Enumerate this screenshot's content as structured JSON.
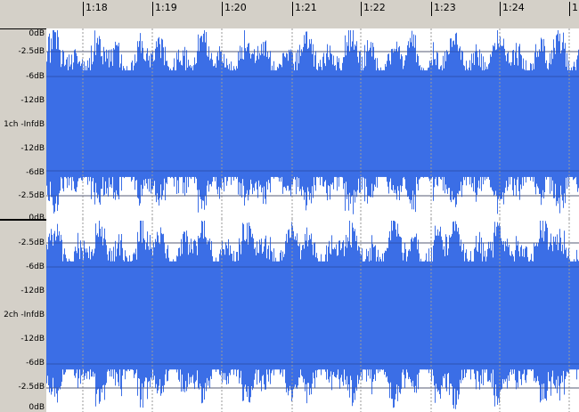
{
  "timeline": {
    "ticks": [
      "1:18",
      "1:19",
      "1:20",
      "1:21",
      "1:22",
      "1:23",
      "1:24",
      "1"
    ]
  },
  "channels": [
    {
      "name": "1ch",
      "db_labels": [
        "0dB",
        "-2.5dB",
        "-6dB",
        "-12dB",
        "1ch -InfdB",
        "-12dB",
        "-6dB",
        "-2.5dB",
        "0dB"
      ]
    },
    {
      "name": "2ch",
      "db_labels": [
        "-2.5dB",
        "-6dB",
        "-12dB",
        "2ch -InfdB",
        "-12dB",
        "-6dB",
        "-2.5dB",
        "0dB"
      ]
    }
  ],
  "colors": {
    "waveform": "#3b6ee6",
    "background": "#ffffff",
    "chrome": "#d4d0c8",
    "gridline": "#000000",
    "dotted": "#9a9a9a"
  }
}
